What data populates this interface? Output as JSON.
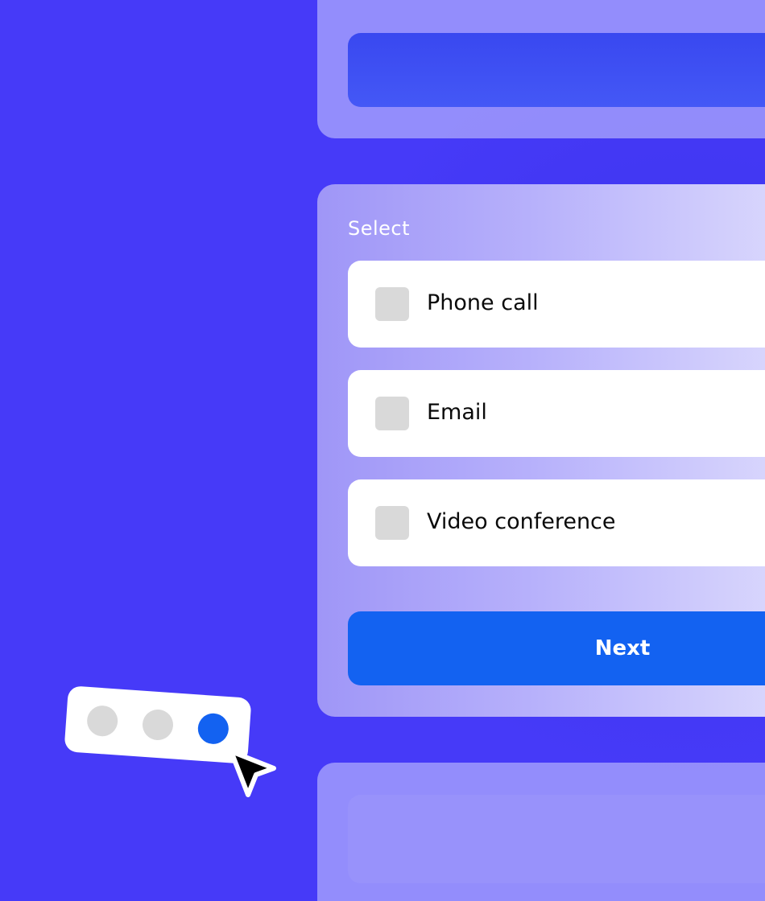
{
  "form": {
    "select_label": "Select",
    "options": [
      {
        "label": "Phone call",
        "checked": false
      },
      {
        "label": "Email",
        "checked": false
      },
      {
        "label": "Video conference",
        "checked": false
      }
    ],
    "next_label": "Next"
  },
  "pager": {
    "total": 3,
    "active_index": 3,
    "inactive_color": "#d9d9d9",
    "active_color": "#1362f1"
  },
  "colors": {
    "background": "#463af8",
    "button": "#1362f1",
    "top_bar": "#3f50f3"
  },
  "icons": {
    "cursor": "mouse-pointer-icon",
    "checkbox": "empty-checkbox"
  }
}
